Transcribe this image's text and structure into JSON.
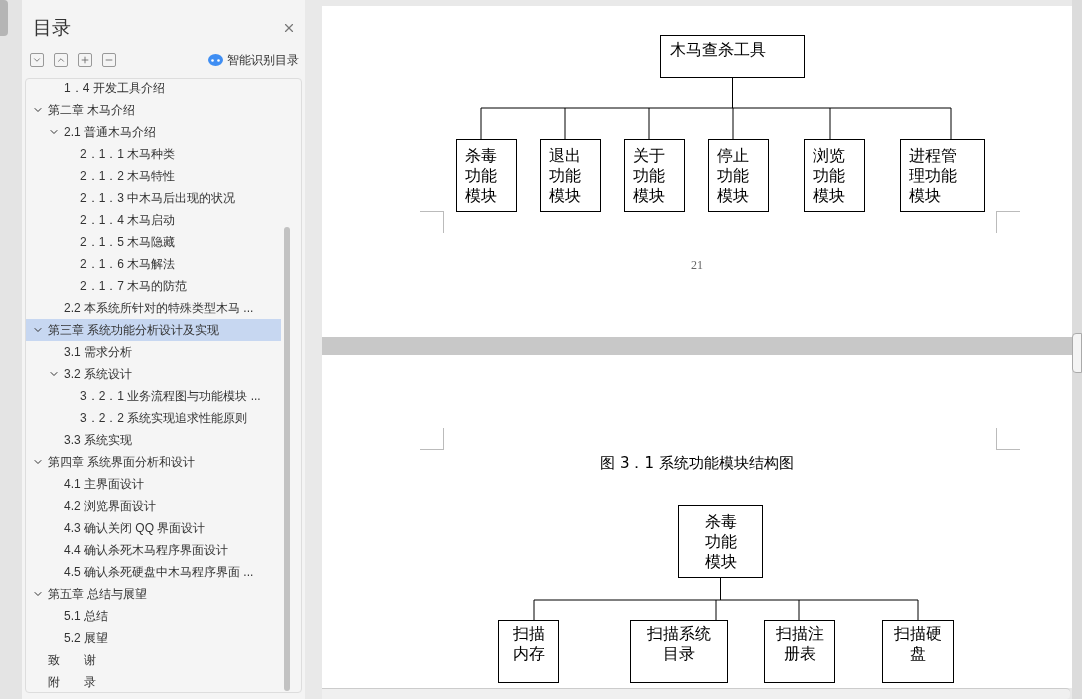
{
  "toc": {
    "title": "目录",
    "toolbar": [
      {
        "kind": "down"
      },
      {
        "kind": "up"
      },
      {
        "kind": "expand"
      },
      {
        "kind": "collapse"
      }
    ],
    "smart_button": "智能识别目录",
    "continued": [
      {
        "label": "1．4 开发工具介绍",
        "selected": false
      }
    ],
    "items": [
      {
        "label": "第二章  木马介绍",
        "selected": false,
        "expanded": true,
        "children": [
          {
            "label": "2.1  普通木马介绍",
            "selected": false,
            "expanded": true,
            "children": [
              {
                "label": "2．1．1 木马种类",
                "selected": false
              },
              {
                "label": "2．1．2 木马特性",
                "selected": false
              },
              {
                "label": "2．1．3 中木马后出现的状况",
                "selected": false
              },
              {
                "label": "2．1．4 木马启动",
                "selected": false
              },
              {
                "label": "2．1．5 木马隐藏",
                "selected": false
              },
              {
                "label": "2．1．6 木马解法",
                "selected": false
              },
              {
                "label": "2．1．7 木马的防范",
                "selected": false
              }
            ]
          },
          {
            "label": "2.2 本系统所针对的特殊类型木马 ...",
            "selected": false
          }
        ]
      },
      {
        "label": "第三章  系统功能分析设计及实现",
        "selected": true,
        "expanded": true,
        "children": [
          {
            "label": "3.1 需求分析",
            "selected": false
          },
          {
            "label": "3.2  系统设计",
            "selected": false,
            "expanded": true,
            "children": [
              {
                "label": "3．2．1 业务流程图与功能模块 ...",
                "selected": false
              },
              {
                "label": "3．2．2  系统实现追求性能原则",
                "selected": false
              }
            ]
          },
          {
            "label": "3.3 系统实现",
            "selected": false
          }
        ]
      },
      {
        "label": "第四章  系统界面分析和设计",
        "selected": false,
        "expanded": true,
        "children": [
          {
            "label": "4.1 主界面设计",
            "selected": false
          },
          {
            "label": "4.2 浏览界面设计",
            "selected": false
          },
          {
            "label": "4.3 确认关闭 QQ 界面设计",
            "selected": false
          },
          {
            "label": "4.4 确认杀死木马程序界面设计",
            "selected": false
          },
          {
            "label": "4.5 确认杀死硬盘中木马程序界面 ...",
            "selected": false
          }
        ]
      },
      {
        "label": "第五章  总结与展望",
        "selected": false,
        "expanded": true,
        "children": [
          {
            "label": "5.1 总结",
            "selected": false
          },
          {
            "label": "5.2 展望",
            "selected": false
          }
        ]
      },
      {
        "label": "致　　谢",
        "selected": false
      },
      {
        "label": "附　　录",
        "selected": false
      }
    ]
  },
  "pages": [
    {
      "diagram": {
        "root": "木马查杀工具",
        "children": [
          "杀毒功能模块",
          "退出功能模块",
          "关于功能模块",
          "停止功能模块",
          "浏览功能模块",
          "进程管理功能模块"
        ]
      },
      "page_number": "21"
    },
    {
      "caption": "图 3．1 系统功能模块结构图",
      "diagram": {
        "root": "杀毒功能模块",
        "children": [
          "扫描内存",
          "扫描系统目录",
          "扫描注册表",
          "扫描硬盘"
        ]
      }
    }
  ]
}
